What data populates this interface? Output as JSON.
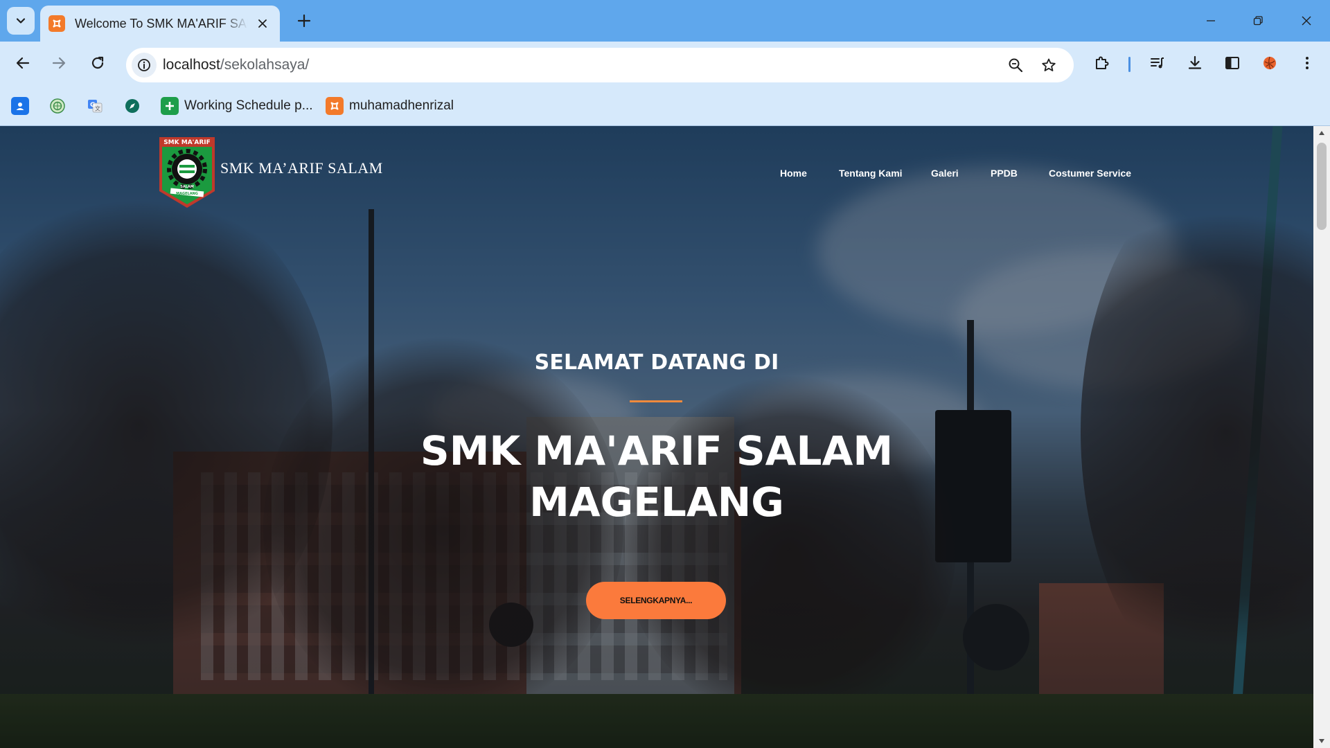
{
  "browser": {
    "tab": {
      "title": "Welcome To SMK MA'ARIF SALAM",
      "favicon": "xampp-icon"
    },
    "url": {
      "host": "localhost",
      "path": "/sekolahsaya/"
    },
    "bookmarks": [
      {
        "label": "",
        "icon": "contacts-icon"
      },
      {
        "label": "",
        "icon": "globe-seal-icon"
      },
      {
        "label": "",
        "icon": "google-translate-icon"
      },
      {
        "label": "",
        "icon": "compass-icon"
      },
      {
        "label": "Working Schedule p...",
        "icon": "sheets-plus-icon"
      },
      {
        "label": "muhamadhenrizal",
        "icon": "xampp-icon"
      }
    ]
  },
  "site": {
    "logo_text": "SMK MA'ARIF",
    "logo_sub": "SALAM",
    "logo_city": "MAGELANG",
    "name": "SMK MA’ARIF SALAM",
    "nav": [
      "Home",
      "Tentang Kami",
      "Galeri",
      "PPDB",
      "Costumer Service"
    ],
    "hero": {
      "welcome": "SELAMAT DATANG DI",
      "line1": "SMK MA'ARIF SALAM",
      "line2": "MAGELANG",
      "cta": "SELENGKAPNYA..."
    }
  },
  "colors": {
    "accent": "#fb7a3c",
    "divider": "#f08a3c",
    "chrome_top": "#5fa7ec",
    "chrome_bar": "#d6e9fb",
    "logo_green": "#1b9a3f",
    "logo_red": "#c0392b"
  }
}
